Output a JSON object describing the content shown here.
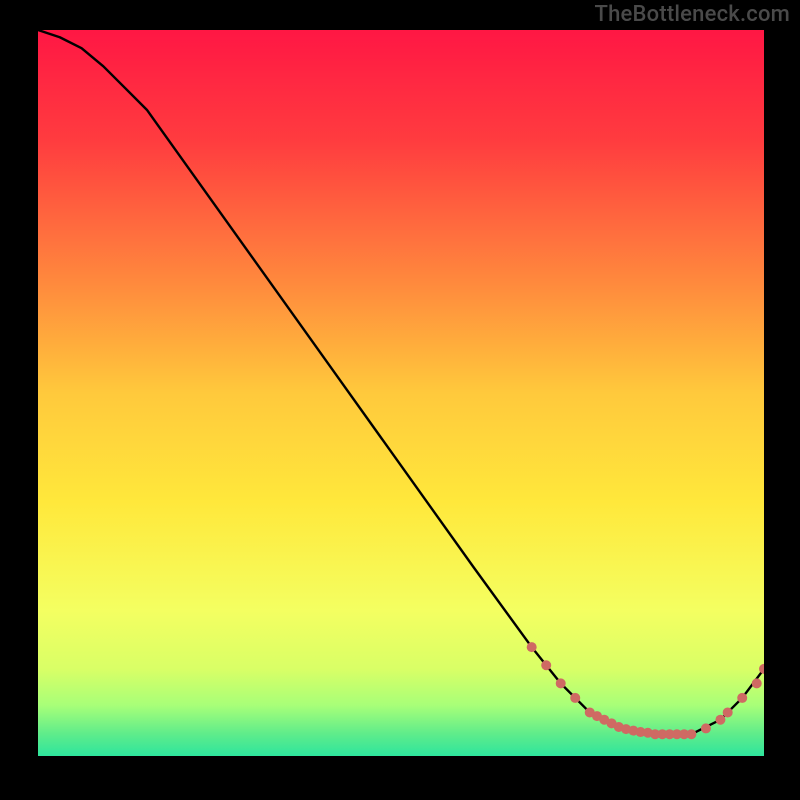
{
  "watermark": "TheBottleneck.com",
  "chart_data": {
    "type": "line",
    "title": "",
    "xlabel": "",
    "ylabel": "",
    "xlim": [
      0,
      100
    ],
    "ylim": [
      0,
      100
    ],
    "grid": false,
    "legend": false,
    "background": "red-yellow-green vertical gradient",
    "series": [
      {
        "name": "curve",
        "color": "#000000",
        "x": [
          0,
          3,
          6,
          9,
          12,
          15,
          20,
          30,
          40,
          50,
          60,
          68,
          72,
          76,
          80,
          85,
          90,
          94,
          97,
          100
        ],
        "values": [
          100,
          99,
          97.5,
          95,
          92,
          89,
          82,
          68,
          54,
          40,
          26,
          15,
          10,
          6,
          4,
          3,
          3,
          5,
          8,
          12
        ]
      }
    ],
    "markers": {
      "name": "highlight-dots",
      "color": "#cf6a63",
      "radius": 5,
      "x": [
        68,
        70,
        72,
        74,
        76,
        77,
        78,
        79,
        80,
        81,
        82,
        83,
        84,
        85,
        86,
        87,
        88,
        89,
        90,
        92,
        94,
        95,
        97,
        99,
        100
      ],
      "values": [
        15,
        12.5,
        10,
        8,
        6,
        5.5,
        5,
        4.5,
        4,
        3.7,
        3.5,
        3.3,
        3.2,
        3,
        3,
        3,
        3,
        3,
        3,
        3.8,
        5,
        6,
        8,
        10,
        12
      ]
    },
    "gradient_stops": [
      {
        "offset": 0.0,
        "color": "#ff1744"
      },
      {
        "offset": 0.15,
        "color": "#ff3b3f"
      },
      {
        "offset": 0.35,
        "color": "#ff8a3d"
      },
      {
        "offset": 0.5,
        "color": "#ffc93c"
      },
      {
        "offset": 0.65,
        "color": "#ffe83b"
      },
      {
        "offset": 0.8,
        "color": "#f4ff61"
      },
      {
        "offset": 0.88,
        "color": "#d9ff66"
      },
      {
        "offset": 0.93,
        "color": "#a8ff78"
      },
      {
        "offset": 0.97,
        "color": "#5eec8b"
      },
      {
        "offset": 1.0,
        "color": "#2ee59d"
      }
    ]
  }
}
